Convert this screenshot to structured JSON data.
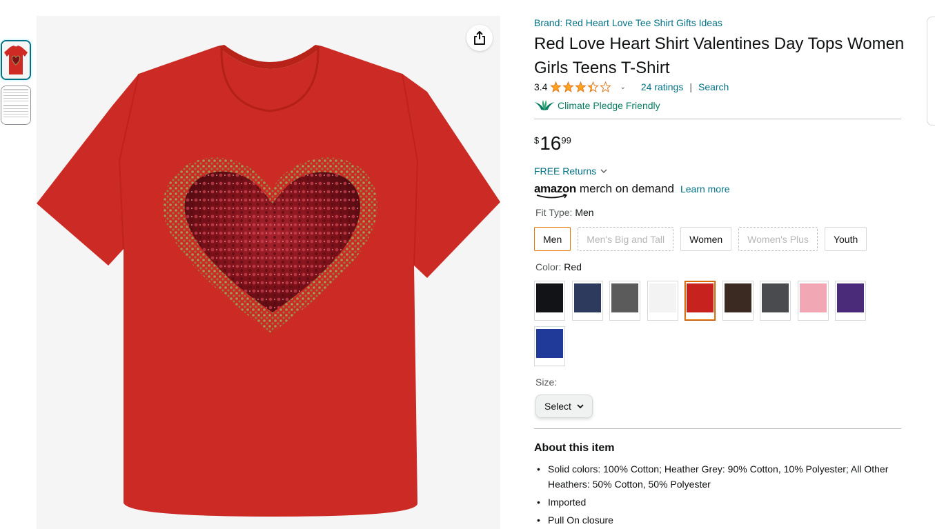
{
  "images": {
    "thumbnails": [
      {
        "name": "shirt-thumbnail",
        "selected": true
      },
      {
        "name": "size-chart-thumbnail",
        "selected": false
      }
    ],
    "share_icon": "share-icon",
    "product_image": "red-tshirt-sequin-heart"
  },
  "product": {
    "brand_link": "Brand: Red Heart Love Tee Shirt Gifts Ideas",
    "title": "Red Love Heart Shirt Valentines Day Tops Women Girls Teens T-Shirt",
    "rating_value": "3.4",
    "rating_fraction": 0.68,
    "ratings_link": "24 ratings",
    "separator": "|",
    "search_link": "Search",
    "climate_label": "Climate Pledge Friendly",
    "price": {
      "symbol": "$",
      "whole": "16",
      "fraction": "99"
    },
    "returns": "FREE Returns",
    "merch": {
      "amazon": "amazon",
      "mod": "merch on demand",
      "learn_more": "Learn more"
    }
  },
  "fit_type": {
    "label": "Fit Type:",
    "value": "Men",
    "options": [
      {
        "label": "Men",
        "state": "selected"
      },
      {
        "label": "Men's Big and Tall",
        "state": "unavailable"
      },
      {
        "label": "Women",
        "state": "available"
      },
      {
        "label": "Women's Plus",
        "state": "unavailable"
      },
      {
        "label": "Youth",
        "state": "available"
      }
    ]
  },
  "color": {
    "label": "Color:",
    "value": "Red",
    "swatches": [
      {
        "name": "Black",
        "hex": "#111316"
      },
      {
        "name": "Navy",
        "hex": "#2d3a5e"
      },
      {
        "name": "Dark Heather",
        "hex": "#5b5b5b"
      },
      {
        "name": "White",
        "hex": "#f3f3f3"
      },
      {
        "name": "Red",
        "hex": "#c8221f",
        "selected": true
      },
      {
        "name": "Brown",
        "hex": "#3a2a22"
      },
      {
        "name": "Heather Grey",
        "hex": "#4a4b4e"
      },
      {
        "name": "Pink",
        "hex": "#f2a7b4"
      },
      {
        "name": "Purple",
        "hex": "#4a2b7a"
      },
      {
        "name": "Royal Blue",
        "hex": "#1f3a99"
      }
    ]
  },
  "size": {
    "label": "Size:",
    "select_label": "Select"
  },
  "about": {
    "title": "About this item",
    "bullets": [
      "Solid colors: 100% Cotton; Heather Grey: 90% Cotton, 10% Polyester; All Other Heathers: 50% Cotton, 50% Polyester",
      "Imported",
      "Pull On closure"
    ]
  },
  "colors": {
    "link": "#007185",
    "climate": "#067d62",
    "star": "#ffa41c",
    "selected_border": "#e77600"
  }
}
